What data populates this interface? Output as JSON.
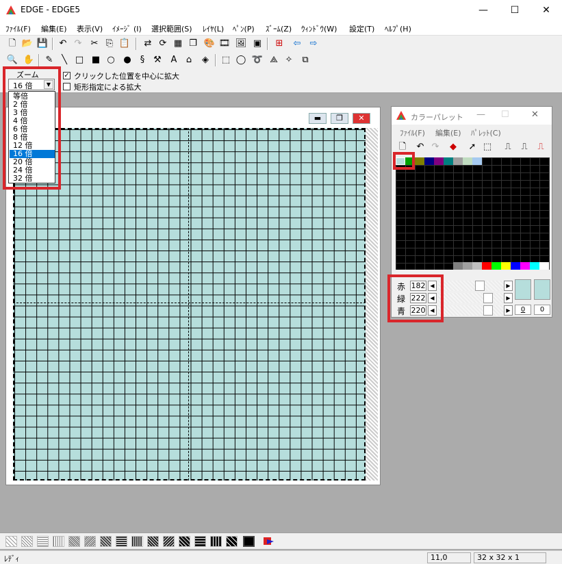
{
  "window": {
    "title": "EDGE - EDGE5",
    "minimize": "—",
    "maximize": "☐",
    "close": "✕"
  },
  "menu": [
    "ﾌｧｲﾙ(F)",
    "編集(E)",
    "表示(V)",
    "ｲﾒｰｼﾞ (I)",
    "選択範囲(S)",
    "ﾚｲﾔ(L)",
    "ﾍﾟﾝ(P)",
    "ｽﾞｰﾑ(Z)",
    "ｳｨﾝﾄﾞｳ(W)",
    "設定(T)",
    "ﾍﾙﾌﾟ(H)"
  ],
  "zoom": {
    "label": "ズーム",
    "selected": "16 倍",
    "options": [
      "等倍",
      "2 倍",
      "3 倍",
      "4 倍",
      "6 倍",
      "8 倍",
      "12 倍",
      "16 倍",
      "20 倍",
      "24 倍",
      "32 倍"
    ],
    "selected_index": 7,
    "check_center": "クリックした位置を中心に拡大",
    "check_rect": "矩形指定による拡大",
    "check_center_on": true
  },
  "palette": {
    "title": "カラーパレット",
    "menu": [
      "ﾌｧｲﾙ(F)",
      "編集(E)",
      "ﾊﾟﾚｯﾄ(C)"
    ],
    "top_colors": [
      "#b6dedc",
      "#00a000",
      "#808000",
      "#000080",
      "#800080",
      "#008080",
      "#a0a0a0",
      "#c0dcc0",
      "#a6caf0"
    ],
    "bottom_colors": [
      "#808080",
      "#a0a0a0",
      "#c0c0c0",
      "#ff0000",
      "#00ff00",
      "#ffff00",
      "#0000ff",
      "#ff00ff",
      "#00ffff",
      "#ffffff"
    ],
    "red_label": "赤",
    "green_label": "緑",
    "blue_label": "青",
    "red": "182",
    "green": "222",
    "blue": "220",
    "fg_index": "0",
    "bg_index": "0",
    "current_color": "#b6dedc"
  },
  "status": {
    "ready": "ﾚﾃﾞｨ",
    "coords": "11,0",
    "size": "32 x 32 x 1"
  }
}
